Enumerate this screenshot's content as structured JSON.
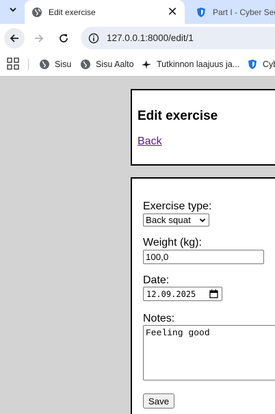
{
  "browser": {
    "tabs": [
      {
        "title": "Edit exercise",
        "active": true,
        "close_label": "✕"
      },
      {
        "title": "Part I - Cyber Security",
        "active": false
      }
    ],
    "url": "127.0.0.1:8000/edit/1",
    "bookmarks": [
      {
        "label": "Sisu",
        "icon": "globe-icon"
      },
      {
        "label": "Sisu Aalto",
        "icon": "globe-icon"
      },
      {
        "label": "Tutkinnon laajuus ja...",
        "icon": "bird-icon"
      },
      {
        "label": "Cyber",
        "icon": "shield-icon"
      }
    ],
    "accent_color": "#d3e3fd"
  },
  "page": {
    "title": "Edit exercise",
    "back_link": "Back"
  },
  "form": {
    "exercise_type_label": "Exercise type:",
    "exercise_type_value": "Back squat",
    "weight_label": "Weight (kg):",
    "weight_value": "100,0",
    "date_label": "Date:",
    "date_value": "12.09.2025",
    "notes_label": "Notes:",
    "notes_value": "Feeling good",
    "save_label": "Save"
  }
}
